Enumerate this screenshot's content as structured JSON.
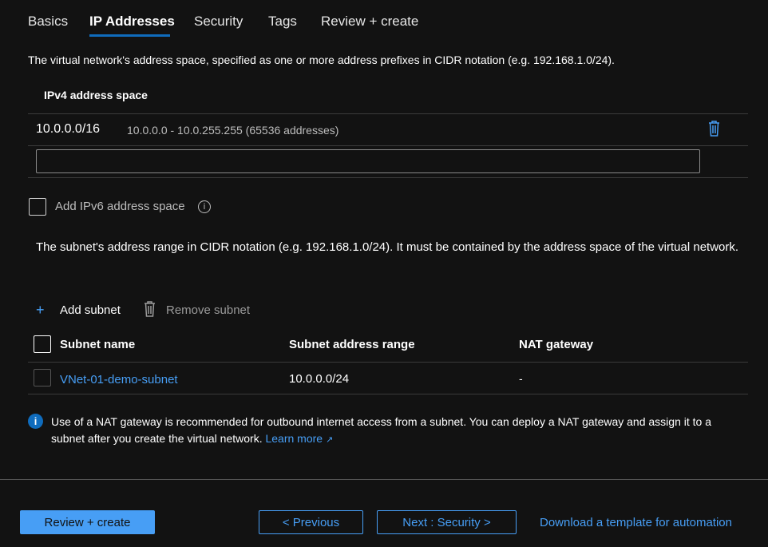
{
  "tabs": [
    "Basics",
    "IP Addresses",
    "Security",
    "Tags",
    "Review + create"
  ],
  "address_space_description": "The virtual network's address space, specified as one or more address prefixes in CIDR notation (e.g. 192.168.1.0/24).",
  "ipv4": {
    "header": "IPv4 address space",
    "entries": [
      {
        "prefix": "10.0.0.0/16",
        "range": "10.0.0.0 - 10.0.255.255 (65536 addresses)"
      }
    ],
    "new_value": ""
  },
  "ipv6_label": "Add IPv6 address space",
  "subnet_description": "The subnet's address range in CIDR notation (e.g. 192.168.1.0/24). It must be contained by the address space of the virtual network.",
  "toolbar": {
    "add": "Add subnet",
    "remove": "Remove subnet"
  },
  "subnet_table": {
    "headers": [
      "Subnet name",
      "Subnet address range",
      "NAT gateway"
    ],
    "rows": [
      {
        "name": "VNet-01-demo-subnet",
        "range": "10.0.0.0/24",
        "nat": "-"
      }
    ]
  },
  "info": {
    "text": "Use of a NAT gateway is recommended for outbound internet access from a subnet. You can deploy a NAT gateway and assign it to a subnet after you create the virtual network.",
    "link": "Learn more"
  },
  "footer": {
    "review": "Review + create",
    "previous": "< Previous",
    "next": "Next : Security >",
    "download": "Download a template for automation"
  }
}
